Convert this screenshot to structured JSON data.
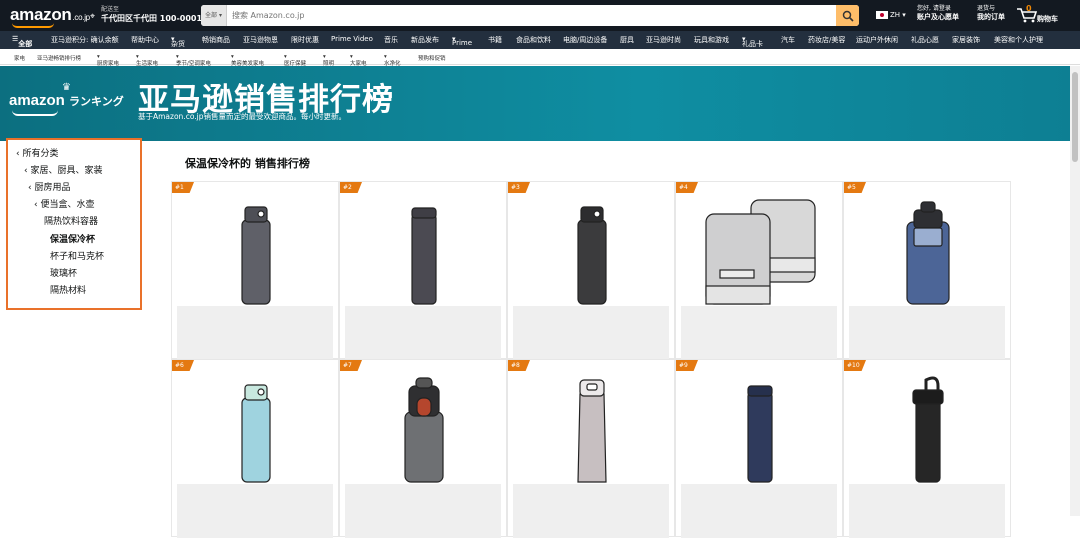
{
  "header": {
    "logo": "amazon",
    "logo_suffix": ".co.jp",
    "deliver_line1": "配送至",
    "deliver_line2": "千代田区千代田 100-0001",
    "search_category": "全部",
    "search_placeholder": "搜索 Amazon.co.jp",
    "lang": "ZH",
    "account_line1": "您好, 请登录",
    "account_line2": "账户及心愿单",
    "orders_line1": "退货与",
    "orders_line2": "我的订单",
    "cart_count": "0",
    "cart_label": "购物车"
  },
  "nav_main": {
    "all": "全部",
    "items": [
      "亚马逊积分: 确认余额",
      "帮助中心",
      "杂货",
      "畅销商品",
      "亚马逊物恩",
      "限时优惠",
      "Prime Video",
      "音乐",
      "新品发布",
      "Prime",
      "书籍",
      "食品和饮料",
      "电脑/周边设备",
      "厨具",
      "亚马逊时尚",
      "玩具和游戏",
      "礼品卡",
      "汽车",
      "药妆店/美容",
      "运动户外休闲",
      "礼品心愿",
      "家居装饰",
      "美容和个人护理"
    ]
  },
  "nav_sub": {
    "items": [
      "家电",
      "亚马逊畅销排行榜",
      "厨房家电",
      "生活家电",
      "季节/空调家电",
      "美容美发家电",
      "医疗保健",
      "照明",
      "大家电",
      "水净化",
      "预购和促销"
    ]
  },
  "banner": {
    "brand": "amazon",
    "brand_suffix": "ランキング",
    "title": "亚马逊销售排行榜",
    "subtitle": "基于Amazon.co.jp销售量而定的最受欢迎商品。每小时更新。"
  },
  "sidebar": {
    "items": [
      {
        "label": "所有分类",
        "chevron": "‹"
      },
      {
        "label": "家居、厨具、家装",
        "chevron": "‹"
      },
      {
        "label": "厨房用品",
        "chevron": "‹"
      },
      {
        "label": "便当盒、水壶",
        "chevron": "‹"
      },
      {
        "label": "隔热饮料容器",
        "chevron": ""
      },
      {
        "label": "保温保冷杯",
        "chevron": "",
        "selected": true
      },
      {
        "label": "杯子和马克杯",
        "chevron": ""
      },
      {
        "label": "玻璃杯",
        "chevron": ""
      },
      {
        "label": "隔热材料",
        "chevron": ""
      }
    ]
  },
  "main": {
    "title": "保温保冷杯的 销售排行榜"
  },
  "products": [
    {
      "rank": "#1",
      "kind": "bottle",
      "body": "#5f6068",
      "cap": "#4e4f56"
    },
    {
      "rank": "#2",
      "kind": "slim",
      "body": "#4b4a52",
      "cap": "#3f3e45"
    },
    {
      "rank": "#3",
      "kind": "bottle",
      "body": "#3b3b3d",
      "cap": "#2d2d2f"
    },
    {
      "rank": "#4",
      "kind": "tumblers",
      "body": "#cfcfd0",
      "cap": "#bdbdbd"
    },
    {
      "rank": "#5",
      "kind": "sport",
      "body": "#4c6597",
      "cap": "#2e2f33"
    },
    {
      "rank": "#6",
      "kind": "bottle",
      "body": "#9fd3df",
      "cap": "#c8e8df"
    },
    {
      "rank": "#7",
      "kind": "wide",
      "body": "#6e7073",
      "cap": "#2f2f31"
    },
    {
      "rank": "#8",
      "kind": "flask",
      "body": "#c7bfc1",
      "cap": "#ece9ea"
    },
    {
      "rank": "#9",
      "kind": "slim",
      "body": "#2f3a5c",
      "cap": "#26304d"
    },
    {
      "rank": "#10",
      "kind": "sport2",
      "body": "#262626",
      "cap": "#1c1c1c"
    }
  ]
}
